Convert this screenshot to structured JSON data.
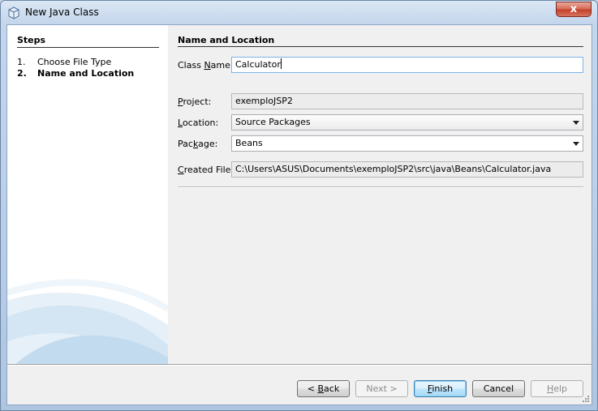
{
  "window": {
    "title": "New Java Class",
    "close_label": "x"
  },
  "steps": {
    "heading": "Steps",
    "items": [
      {
        "num": "1.",
        "label": "Choose File Type",
        "current": false
      },
      {
        "num": "2.",
        "label": "Name and Location",
        "current": true
      }
    ]
  },
  "form": {
    "heading": "Name and Location",
    "class_name": {
      "label_pre": "Class ",
      "label_mn": "N",
      "label_post": "ame:",
      "value": "Calculator"
    },
    "project": {
      "label_pre": "",
      "label_mn": "P",
      "label_post": "roject:",
      "value": "exemploJSP2"
    },
    "location": {
      "label_pre": "",
      "label_mn": "L",
      "label_post": "ocation:",
      "value": "Source Packages"
    },
    "package": {
      "label_pre": "Pac",
      "label_mn": "k",
      "label_post": "age:",
      "value": "Beans"
    },
    "created_file": {
      "label_pre": "",
      "label_mn": "C",
      "label_post": "reated File:",
      "value": "C:\\Users\\ASUS\\Documents\\exemploJSP2\\src\\java\\Beans\\Calculator.java"
    }
  },
  "buttons": {
    "back": {
      "pre": "< ",
      "mn": "B",
      "post": "ack",
      "enabled": true
    },
    "next": {
      "pre": "Next >",
      "mn": "",
      "post": "",
      "enabled": false
    },
    "finish": {
      "pre": "",
      "mn": "F",
      "post": "inish",
      "enabled": true
    },
    "cancel": {
      "pre": "Cancel",
      "mn": "",
      "post": "",
      "enabled": true
    },
    "help": {
      "pre": "",
      "mn": "H",
      "post": "elp",
      "enabled": false
    }
  },
  "colors": {
    "accent": "#3c7fb1",
    "close_button": "#c4412b"
  },
  "icons": {
    "app": "java-class-icon",
    "dropdown": "chevron-down-icon"
  }
}
